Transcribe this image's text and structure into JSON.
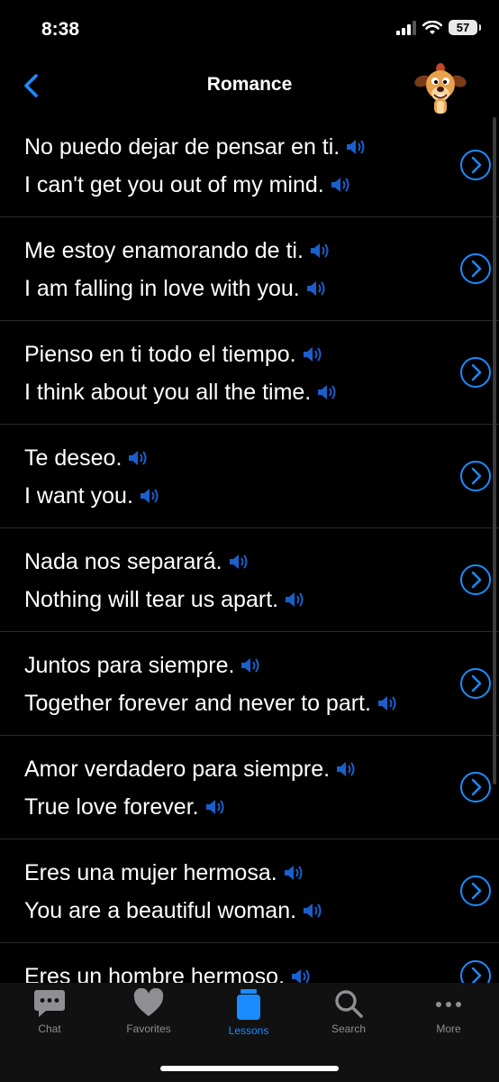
{
  "status": {
    "time": "8:38",
    "battery": "57"
  },
  "nav": {
    "title": "Romance"
  },
  "colors": {
    "accent": "#1a8cff",
    "background": "#000000"
  },
  "phrases": [
    {
      "es": "No puedo dejar de pensar en ti.",
      "en": "I can't get you out of my mind."
    },
    {
      "es": "Me estoy enamorando de ti.",
      "en": "I am falling in love with you."
    },
    {
      "es": "Pienso en ti todo el tiempo.",
      "en": "I think about you all the time."
    },
    {
      "es": "Te deseo.",
      "en": "I want you."
    },
    {
      "es": "Nada nos separará.",
      "en": "Nothing will tear us apart."
    },
    {
      "es": "Juntos para siempre.",
      "en": "Together forever and never to part."
    },
    {
      "es": "Amor verdadero para siempre.",
      "en": "True love forever."
    },
    {
      "es": "Eres una mujer hermosa.",
      "en": "You are a beautiful woman."
    },
    {
      "es": "Eres un hombre hermoso.",
      "en": ""
    }
  ],
  "tabs": [
    {
      "label": "Chat",
      "icon": "chat-icon"
    },
    {
      "label": "Favorites",
      "icon": "heart-icon"
    },
    {
      "label": "Lessons",
      "icon": "lessons-icon"
    },
    {
      "label": "Search",
      "icon": "search-icon"
    },
    {
      "label": "More",
      "icon": "more-icon"
    }
  ]
}
